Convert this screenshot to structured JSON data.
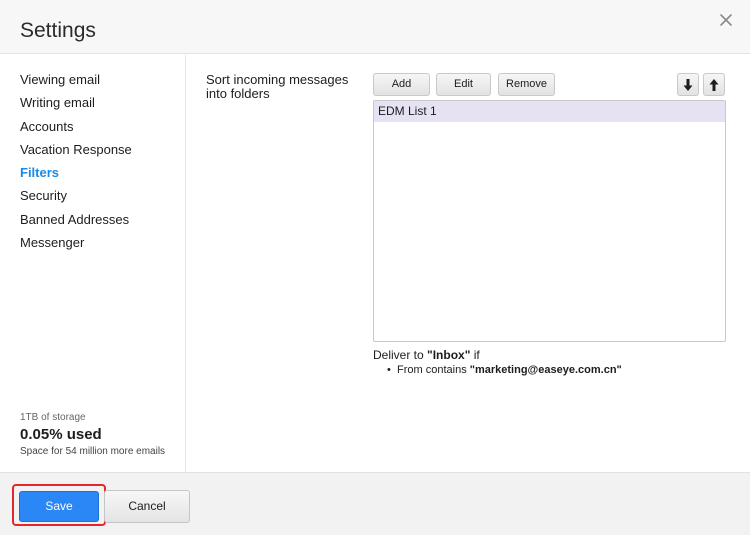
{
  "dialog": {
    "title": "Settings",
    "close_icon": "close-icon"
  },
  "sidebar": {
    "items": [
      {
        "label": "Viewing email",
        "active": false
      },
      {
        "label": "Writing email",
        "active": false
      },
      {
        "label": "Accounts",
        "active": false
      },
      {
        "label": "Vacation Response",
        "active": false
      },
      {
        "label": "Filters",
        "active": true
      },
      {
        "label": "Security",
        "active": false
      },
      {
        "label": "Banned Addresses",
        "active": false
      },
      {
        "label": "Messenger",
        "active": false
      }
    ],
    "storage": {
      "capacity": "1TB of storage",
      "used": "0.05% used",
      "space": "Space for 54 million more emails"
    }
  },
  "filters": {
    "section_label": "Sort incoming messages into folders",
    "toolbar": {
      "add_label": "Add",
      "edit_label": "Edit",
      "remove_label": "Remove",
      "move_down_icon": "arrow-down-icon",
      "move_up_icon": "arrow-up-icon"
    },
    "list": [
      {
        "name": "EDM List 1",
        "selected": true
      }
    ],
    "detail": {
      "deliver_prefix": "Deliver to ",
      "folder": "\"Inbox\"",
      "deliver_suffix": " if",
      "condition_bullet": "•",
      "condition_prefix": "From contains ",
      "condition_value": "\"marketing@easeye.com.cn\""
    }
  },
  "footer": {
    "save_label": "Save",
    "cancel_label": "Cancel"
  },
  "colors": {
    "accent": "#1a8ae6",
    "primary_button": "#2b87f5",
    "highlight": "#e4272d",
    "selected_row": "#e6e2f4"
  }
}
